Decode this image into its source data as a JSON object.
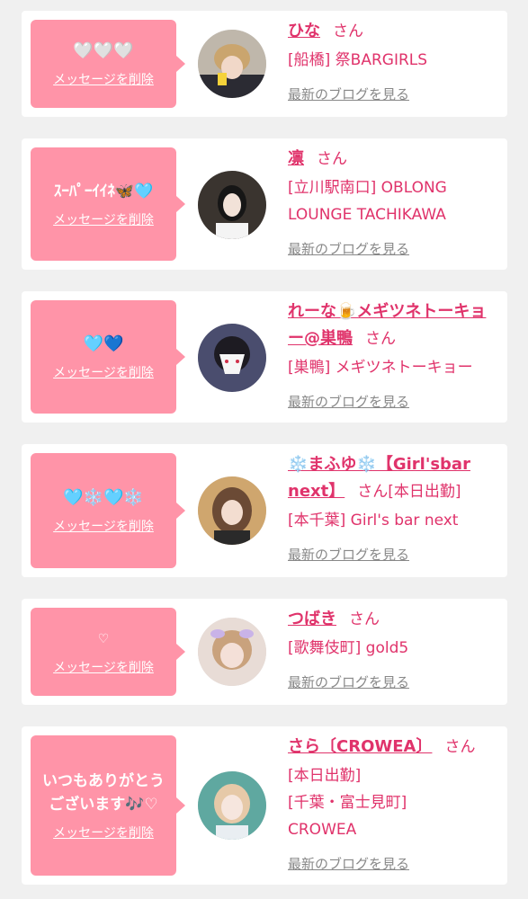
{
  "cards": [
    {
      "message": "🤍🤍🤍",
      "delete_label": "メッセージを削除",
      "name": "ひな",
      "honorific": "さん",
      "shop": "[船橋] 祭BARGIRLS",
      "blog_label": "最新のブログを見る"
    },
    {
      "message": "ｽｰﾊﾟｰｲｲﾈ🦋🩵",
      "delete_label": "メッセージを削除",
      "name": "凛",
      "honorific": "さん",
      "shop": "[立川駅南口] OBLONG LOUNGE TACHIKAWA",
      "blog_label": "最新のブログを見る"
    },
    {
      "message": "🩵💙",
      "delete_label": "メッセージを削除",
      "name": "れーな🍺メギツネトーキョー@巣鴨",
      "honorific": "さん",
      "shop": "[巣鴨] メギツネトーキョー",
      "blog_label": "最新のブログを見る"
    },
    {
      "message": "🩵❄️🩵❄️",
      "delete_label": "メッセージを削除",
      "name": "❄️まふゆ❄️【Girl'sbar next】",
      "honorific": "さん",
      "status": "[本日出勤]",
      "shop": "[本千葉] Girl's bar next",
      "blog_label": "最新のブログを見る"
    },
    {
      "message": "♡",
      "delete_label": "メッセージを削除",
      "name": "つばき",
      "honorific": "さん",
      "shop": "[歌舞伎町] gold5",
      "blog_label": "最新のブログを見る"
    },
    {
      "message": "いつもありがとう\nございます🎶♡",
      "delete_label": "メッセージを削除",
      "name": "さら〔CROWEA〕",
      "honorific": "さん",
      "status": "[本日出勤]",
      "shop": "[千葉・富士見町] CROWEA",
      "blog_label": "最新のブログを見る"
    }
  ],
  "colors": {
    "accent": "#e0336b",
    "bubble": "#ff94a8",
    "muted": "#888888"
  }
}
